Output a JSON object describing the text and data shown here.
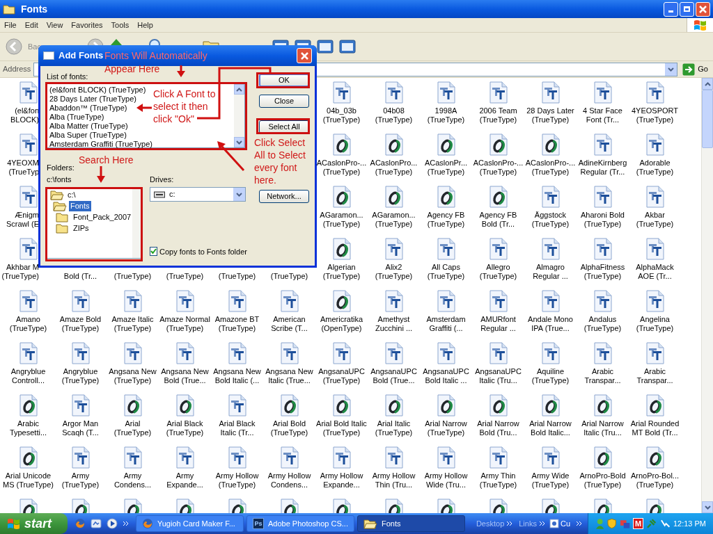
{
  "window": {
    "title": "Fonts"
  },
  "menu": [
    "File",
    "Edit",
    "View",
    "Favorites",
    "Tools",
    "Help"
  ],
  "toolbar": {
    "back_label": "Bac"
  },
  "address_bar": {
    "label": "Address",
    "go_label": "Go"
  },
  "icon_rows": [
    [
      {
        "kind": "truetype",
        "lines": [
          "(el&fon",
          "BLOCK)"
        ]
      },
      {
        "kind": "covered"
      },
      {
        "kind": "covered"
      },
      {
        "kind": "covered"
      },
      {
        "kind": "covered"
      },
      {
        "kind": "covered"
      },
      {
        "kind": "truetype",
        "lines": [
          "04b_03b",
          "(TrueType)"
        ]
      },
      {
        "kind": "truetype",
        "lines": [
          "04b08",
          "(TrueType)"
        ]
      },
      {
        "kind": "truetype",
        "lines": [
          "1998A",
          "(TrueType)"
        ]
      },
      {
        "kind": "truetype",
        "lines": [
          "2006 Team",
          "(TrueType)"
        ]
      },
      {
        "kind": "truetype",
        "lines": [
          "28 Days Later",
          "(TrueType)"
        ]
      },
      {
        "kind": "truetype",
        "lines": [
          "4 Star Face",
          "Font (Tr..."
        ]
      },
      {
        "kind": "truetype",
        "lines": [
          "4YEOSPORT",
          "(TrueType)"
        ]
      }
    ],
    [
      {
        "kind": "truetype",
        "lines": [
          "4YEOXM",
          "(TrueTyp"
        ]
      },
      {
        "kind": "covered"
      },
      {
        "kind": "covered"
      },
      {
        "kind": "covered"
      },
      {
        "kind": "covered"
      },
      {
        "kind": "covered"
      },
      {
        "kind": "opentype",
        "lines": [
          "ACaslonPro-...",
          "(TrueType)"
        ]
      },
      {
        "kind": "opentype",
        "lines": [
          "ACaslonPro...",
          "(TrueType)"
        ]
      },
      {
        "kind": "opentype",
        "lines": [
          "ACaslonPr...",
          "(TrueType)"
        ]
      },
      {
        "kind": "opentype",
        "lines": [
          "ACaslonPro-...",
          "(TrueType)"
        ]
      },
      {
        "kind": "opentype",
        "lines": [
          "ACaslonPro-...",
          "(TrueType)"
        ]
      },
      {
        "kind": "truetype",
        "lines": [
          "AdineKirnberg",
          "Regular (Tr..."
        ]
      },
      {
        "kind": "truetype",
        "lines": [
          "Adorable",
          "(TrueType)"
        ]
      }
    ],
    [
      {
        "kind": "truetype",
        "lines": [
          "Ænigm",
          "Scrawl (E"
        ]
      },
      {
        "kind": "covered"
      },
      {
        "kind": "covered"
      },
      {
        "kind": "covered"
      },
      {
        "kind": "covered"
      },
      {
        "kind": "covered"
      },
      {
        "kind": "opentype",
        "lines": [
          "AGaramon...",
          "(TrueType)"
        ]
      },
      {
        "kind": "opentype",
        "lines": [
          "AGaramon...",
          "(TrueType)"
        ]
      },
      {
        "kind": "opentype",
        "lines": [
          "Agency FB",
          "(TrueType)"
        ]
      },
      {
        "kind": "opentype",
        "lines": [
          "Agency FB",
          "Bold (Tr..."
        ]
      },
      {
        "kind": "truetype",
        "lines": [
          "Äggstock",
          "(TrueType)"
        ]
      },
      {
        "kind": "truetype",
        "lines": [
          "Aharoni Bold",
          "(TrueType)"
        ]
      },
      {
        "kind": "truetype",
        "lines": [
          "Akbar",
          "(TrueType)"
        ]
      }
    ],
    [
      {
        "kind": "truetype",
        "lines": [
          "Akhbar M",
          "(TrueType)"
        ]
      },
      {
        "kind": "label",
        "lines": [
          "Bold (Tr..."
        ]
      },
      {
        "kind": "label",
        "lines": [
          "(TrueType)"
        ]
      },
      {
        "kind": "label",
        "lines": [
          "(TrueType)"
        ]
      },
      {
        "kind": "label",
        "lines": [
          "(TrueType)"
        ]
      },
      {
        "kind": "label",
        "lines": [
          "(TrueType)"
        ]
      },
      {
        "kind": "opentype",
        "lines": [
          "Algerian",
          "(TrueType)"
        ]
      },
      {
        "kind": "truetype",
        "lines": [
          "Alix2",
          "(TrueType)"
        ]
      },
      {
        "kind": "truetype",
        "lines": [
          "All Caps",
          "(TrueType)"
        ]
      },
      {
        "kind": "truetype",
        "lines": [
          "Allegro",
          "(TrueType)"
        ]
      },
      {
        "kind": "truetype",
        "lines": [
          "Almagro",
          "Regular ..."
        ]
      },
      {
        "kind": "truetype",
        "lines": [
          "AlphaFitness",
          "(TrueType)"
        ]
      },
      {
        "kind": "truetype",
        "lines": [
          "AlphaMack",
          "AOE (Tr..."
        ]
      }
    ],
    [
      {
        "kind": "truetype",
        "lines": [
          "Amano",
          "(TrueType)"
        ]
      },
      {
        "kind": "truetype",
        "lines": [
          "Amaze Bold",
          "(TrueType)"
        ]
      },
      {
        "kind": "truetype",
        "lines": [
          "Amaze Italic",
          "(TrueType)"
        ]
      },
      {
        "kind": "truetype",
        "lines": [
          "Amaze Normal",
          "(TrueType)"
        ]
      },
      {
        "kind": "truetype",
        "lines": [
          "Amazone BT",
          "(TrueType)"
        ]
      },
      {
        "kind": "truetype",
        "lines": [
          "American",
          "Scribe (T..."
        ]
      },
      {
        "kind": "opentype",
        "lines": [
          "Americratika",
          "(OpenType)"
        ]
      },
      {
        "kind": "truetype",
        "lines": [
          "Amethyst",
          "Zucchini ..."
        ]
      },
      {
        "kind": "truetype",
        "lines": [
          "Amsterdam",
          "Graffiti (..."
        ]
      },
      {
        "kind": "truetype",
        "lines": [
          "AMURfont",
          "Regular ..."
        ]
      },
      {
        "kind": "truetype",
        "lines": [
          "Andale Mono",
          "IPA (True..."
        ]
      },
      {
        "kind": "truetype",
        "lines": [
          "Andalus",
          "(TrueType)"
        ]
      },
      {
        "kind": "truetype",
        "lines": [
          "Angelina",
          "(TrueType)"
        ]
      }
    ],
    [
      {
        "kind": "truetype",
        "lines": [
          "Angryblue",
          "Controll..."
        ]
      },
      {
        "kind": "truetype",
        "lines": [
          "Angryblue",
          "(TrueType)"
        ]
      },
      {
        "kind": "truetype",
        "lines": [
          "Angsana New",
          "(TrueType)"
        ]
      },
      {
        "kind": "truetype",
        "lines": [
          "Angsana New",
          "Bold (True..."
        ]
      },
      {
        "kind": "truetype",
        "lines": [
          "Angsana New",
          "Bold Italic (..."
        ]
      },
      {
        "kind": "truetype",
        "lines": [
          "Angsana New",
          "Italic (True..."
        ]
      },
      {
        "kind": "truetype",
        "lines": [
          "AngsanaUPC",
          "(TrueType)"
        ]
      },
      {
        "kind": "truetype",
        "lines": [
          "AngsanaUPC",
          "Bold (True..."
        ]
      },
      {
        "kind": "truetype",
        "lines": [
          "AngsanaUPC",
          "Bold Italic ..."
        ]
      },
      {
        "kind": "truetype",
        "lines": [
          "AngsanaUPC",
          "Italic (Tru..."
        ]
      },
      {
        "kind": "truetype",
        "lines": [
          "Aquiline",
          "(TrueType)"
        ]
      },
      {
        "kind": "truetype",
        "lines": [
          "Arabic",
          "Transpar..."
        ]
      },
      {
        "kind": "truetype",
        "lines": [
          "Arabic",
          "Transpar..."
        ]
      }
    ],
    [
      {
        "kind": "opentype",
        "lines": [
          "Arabic",
          "Typesetti..."
        ]
      },
      {
        "kind": "truetype",
        "lines": [
          "Argor Man",
          "Scaqh (T..."
        ]
      },
      {
        "kind": "opentype",
        "lines": [
          "Arial",
          "(TrueType)"
        ]
      },
      {
        "kind": "opentype",
        "lines": [
          "Arial Black",
          "(TrueType)"
        ]
      },
      {
        "kind": "truetype",
        "lines": [
          "Arial Black",
          "Italic (Tr..."
        ]
      },
      {
        "kind": "opentype",
        "lines": [
          "Arial Bold",
          "(TrueType)"
        ]
      },
      {
        "kind": "opentype",
        "lines": [
          "Arial Bold Italic",
          "(TrueType)"
        ]
      },
      {
        "kind": "opentype",
        "lines": [
          "Arial Italic",
          "(TrueType)"
        ]
      },
      {
        "kind": "opentype",
        "lines": [
          "Arial Narrow",
          "(TrueType)"
        ]
      },
      {
        "kind": "opentype",
        "lines": [
          "Arial Narrow",
          "Bold (Tru..."
        ]
      },
      {
        "kind": "opentype",
        "lines": [
          "Arial Narrow",
          "Bold Italic..."
        ]
      },
      {
        "kind": "opentype",
        "lines": [
          "Arial Narrow",
          "Italic (Tru..."
        ]
      },
      {
        "kind": "opentype",
        "lines": [
          "Arial Rounded",
          "MT Bold (Tr..."
        ]
      }
    ],
    [
      {
        "kind": "opentype",
        "lines": [
          "Arial Unicode",
          "MS (TrueType)"
        ]
      },
      {
        "kind": "truetype",
        "lines": [
          "Army",
          "(TrueType)"
        ]
      },
      {
        "kind": "truetype",
        "lines": [
          "Army",
          "Condens..."
        ]
      },
      {
        "kind": "truetype",
        "lines": [
          "Army",
          "Expande..."
        ]
      },
      {
        "kind": "truetype",
        "lines": [
          "Army Hollow",
          "(TrueType)"
        ]
      },
      {
        "kind": "truetype",
        "lines": [
          "Army Hollow",
          "Condens..."
        ]
      },
      {
        "kind": "truetype",
        "lines": [
          "Army Hollow",
          "Expande..."
        ]
      },
      {
        "kind": "truetype",
        "lines": [
          "Army Hollow",
          "Thin (Tru..."
        ]
      },
      {
        "kind": "truetype",
        "lines": [
          "Army Hollow",
          "Wide (Tru..."
        ]
      },
      {
        "kind": "truetype",
        "lines": [
          "Army Thin",
          "(TrueType)"
        ]
      },
      {
        "kind": "truetype",
        "lines": [
          "Army Wide",
          "(TrueType)"
        ]
      },
      {
        "kind": "opentype",
        "lines": [
          "ArnoPro-Bold",
          "(TrueType)"
        ]
      },
      {
        "kind": "opentype",
        "lines": [
          "ArnoPro-Bol...",
          "(TrueType)"
        ]
      }
    ],
    [
      {
        "kind": "opentype"
      },
      {
        "kind": "opentype"
      },
      {
        "kind": "opentype"
      },
      {
        "kind": "opentype"
      },
      {
        "kind": "opentype"
      },
      {
        "kind": "opentype"
      },
      {
        "kind": "opentype"
      },
      {
        "kind": "opentype"
      },
      {
        "kind": "opentype"
      },
      {
        "kind": "opentype"
      },
      {
        "kind": "opentype"
      },
      {
        "kind": "opentype"
      },
      {
        "kind": "opentype"
      }
    ]
  ],
  "dialog": {
    "title": "Add Fonts",
    "list_label": "List of fonts:",
    "fonts": [
      "(el&font BLOCK) (TrueType)",
      "28 Days Later (TrueType)",
      "Abaddon™ (TrueType)",
      "Alba (TrueType)",
      "Alba Matter (TrueType)",
      "Alba Super (TrueType)",
      "Amsterdam Graffiti (TrueType)"
    ],
    "buttons": [
      {
        "label": "OK",
        "kind": "default"
      },
      {
        "label": "Close",
        "kind": "normal"
      },
      {
        "label": "Select All",
        "kind": "normal"
      }
    ],
    "folders_label": "Folders:",
    "current_path": "c:\\fonts",
    "folder_tree": [
      {
        "name": "c:\\",
        "expanded": true,
        "selected": false,
        "children": [
          {
            "name": "Fonts",
            "expanded": true,
            "selected": true,
            "children": [
              {
                "name": "Font_Pack_2007",
                "expanded": false,
                "selected": false
              },
              {
                "name": "ZIPs",
                "expanded": false,
                "selected": false
              }
            ]
          }
        ]
      }
    ],
    "drives_label": "Drives:",
    "drive": "c:",
    "network_button": "Network...",
    "copy_checkbox": {
      "label": "Copy fonts to Fonts folder",
      "checked": true
    }
  },
  "annotations": [
    {
      "text": "Fonts Will Automatically"
    },
    {
      "text": "Appear Here"
    },
    {
      "text": "Click A Font to select it then click \"Ok\""
    },
    {
      "text": "Search Here"
    },
    {
      "text": "Click Select All to Select every font here."
    }
  ],
  "taskbar": {
    "start_label": "start",
    "tasks": [
      {
        "label": "Yugioh Card Maker F...",
        "kind": "browser",
        "selected": false
      },
      {
        "label": "Adobe Photoshop CS...",
        "kind": "photoshop",
        "icon_text": "Ps",
        "selected": false
      },
      {
        "label": "Fonts",
        "kind": "folder",
        "selected": true
      }
    ],
    "toolbars": [
      "Desktop",
      "Links"
    ],
    "link_label": "Cu",
    "tray_badge": "M",
    "clock": "12:13 PM"
  }
}
